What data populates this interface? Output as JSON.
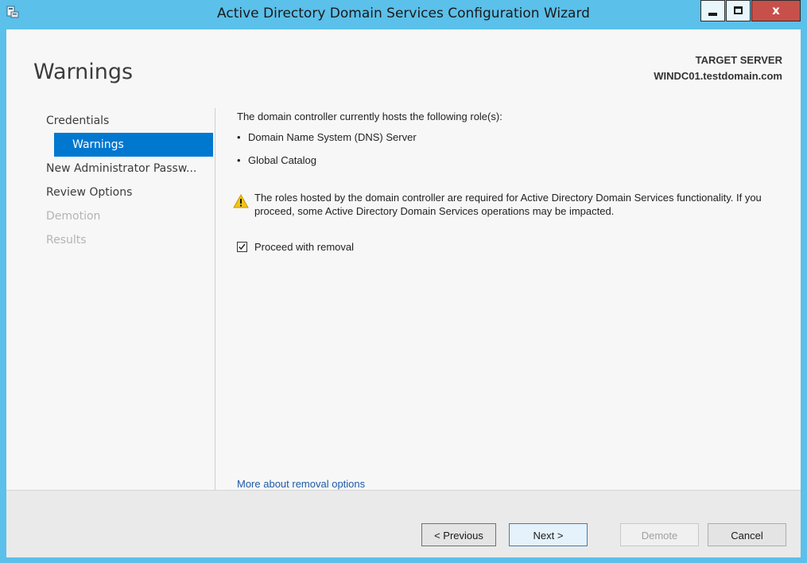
{
  "window": {
    "title": "Active Directory Domain Services Configuration Wizard",
    "close_glyph": "x",
    "icons": [
      "app-icon",
      "minimize-icon",
      "maximize-icon",
      "close-icon"
    ]
  },
  "header": {
    "page_title": "Warnings",
    "target_label": "TARGET SERVER",
    "target_value": "WINDC01.testdomain.com"
  },
  "nav": {
    "items": [
      {
        "label": "Credentials",
        "state": "normal"
      },
      {
        "label": "Warnings",
        "state": "selected"
      },
      {
        "label": "New Administrator Passw...",
        "state": "normal"
      },
      {
        "label": "Review Options",
        "state": "normal"
      },
      {
        "label": "Demotion",
        "state": "disabled"
      },
      {
        "label": "Results",
        "state": "disabled"
      }
    ]
  },
  "content": {
    "intro": "The domain controller currently hosts the following role(s):",
    "roles": [
      "Domain Name System (DNS) Server",
      "Global Catalog"
    ],
    "bullet": "•",
    "warning": "The roles hosted by the domain controller are required for Active Directory Domain Services functionality. If you proceed, some Active Directory Domain Services operations may be impacted.",
    "checkbox_label": "Proceed with removal",
    "checkbox_checked": true,
    "more_link": "More about removal options"
  },
  "footer": {
    "previous": "< Previous",
    "next": "Next >",
    "demote": "Demote",
    "cancel": "Cancel"
  },
  "colors": {
    "titlebar": "#5bc0ea",
    "selection": "#0078d0",
    "close_button": "#c7504a",
    "link": "#1e5aa8",
    "warning": "#f0c419"
  }
}
